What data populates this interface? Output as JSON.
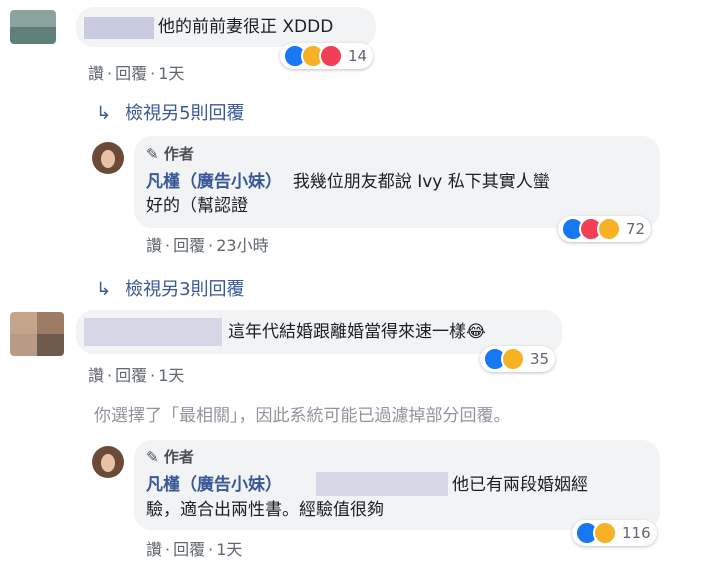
{
  "comment1": {
    "text": "他的前前妻很正 XDDD",
    "reaction_count": "14",
    "actions": {
      "like": "讚",
      "reply": "回覆",
      "time": "1天"
    },
    "view_more": "檢視另5則回覆"
  },
  "reply1": {
    "badge": "作者",
    "author": "凡槿（廣告小妹）",
    "text_line1": "我幾位朋友都說 Ivy 私下其實人蠻",
    "text_line2": "好的（幫認證",
    "reaction_count": "72",
    "actions": {
      "like": "讚",
      "reply": "回覆",
      "time": "23小時"
    }
  },
  "view_more2": "檢視另3則回覆",
  "comment2": {
    "text": "這年代結婚跟離婚當得來速一樣😂",
    "reaction_count": "35",
    "actions": {
      "like": "讚",
      "reply": "回覆",
      "time": "1天"
    }
  },
  "filter_notice": "你選擇了「最相關」，因此系統可能已過濾掉部分回覆。",
  "reply2": {
    "badge": "作者",
    "author": "凡槿（廣告小妹）",
    "text_line1": "他已有兩段婚姻經",
    "text_line2": "驗，適合出兩性書。經驗值很夠",
    "reaction_count": "116",
    "actions": {
      "like": "讚",
      "reply": "回覆",
      "time": "1天"
    }
  },
  "colors": {
    "link": "#385898",
    "meta": "#616770",
    "bubble": "#f2f3f5",
    "like": "#1877f2",
    "love": "#f33e58",
    "haha": "#f7b125"
  }
}
